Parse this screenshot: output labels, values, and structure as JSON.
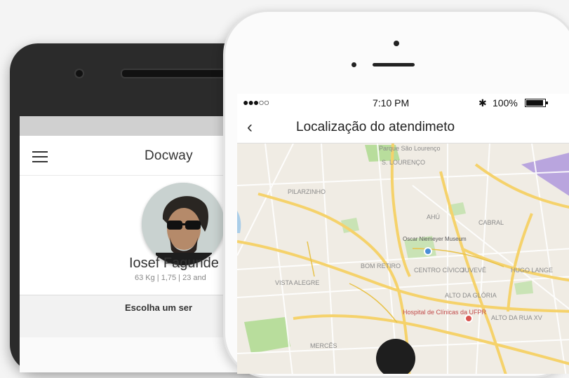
{
  "android": {
    "app_logo": "Docway",
    "profile": {
      "name": "Iosef Fagunde",
      "stats": "63 Kg | 1,75 | 23 and",
      "next_label": "Escolha um ser"
    }
  },
  "iphone": {
    "status": {
      "signal": "●●●○○",
      "time": "7:10 PM",
      "bluetooth": "✱",
      "battery_pct": "100%"
    },
    "nav": {
      "back_icon": "‹",
      "title": "Localização do atendimeto"
    },
    "map": {
      "labels": [
        "Parque São Lourenço",
        "S. LOURENÇO",
        "PILARZINHO",
        "AHÚ",
        "CABRAL",
        "Oscar Niemeyer Museum",
        "BOM RETIRO",
        "CENTRO CÍVICO",
        "JUVEVÊ",
        "HUGO LANGE",
        "VISTA ALEGRE",
        "ALTO DA GLÓRIA",
        "Hospital de Clínicas da UFPR",
        "ALTO DA RUA XV",
        "MERCÊS"
      ],
      "colors": {
        "land": "#f0ece4",
        "road": "#f5d26b",
        "park": "#b8dd9c",
        "water": "#a9cde8",
        "hospital": "#d9534f"
      }
    }
  }
}
